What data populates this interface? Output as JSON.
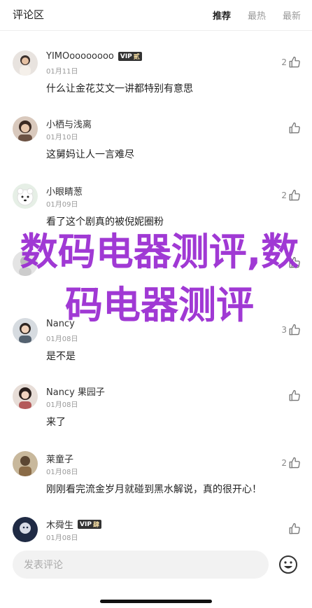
{
  "header": {
    "title": "评论区",
    "tabs": [
      "推荐",
      "最热",
      "最新"
    ]
  },
  "comments": [
    {
      "name": "YIMOoooooooo",
      "vip": "VIP",
      "vip_tag": "贰",
      "date": "01月11日",
      "text": "什么让金花艾文一讲都特别有意思",
      "likes": "2"
    },
    {
      "name": "小栖与浅离",
      "vip": "",
      "vip_tag": "",
      "date": "01月10日",
      "text": "这舅妈让人一言难尽",
      "likes": ""
    },
    {
      "name": "小眼睛葱",
      "vip": "",
      "vip_tag": "",
      "date": "01月09日",
      "text": "看了这个剧真的被倪妮圈粉",
      "likes": "2"
    },
    {
      "name": "",
      "vip": "",
      "vip_tag": "",
      "date": "",
      "text": "",
      "likes": ""
    },
    {
      "name": "Nancy",
      "vip": "",
      "vip_tag": "",
      "date": "01月08日",
      "text": "是不是",
      "likes": "3"
    },
    {
      "name": "Nancy 果园子",
      "vip": "",
      "vip_tag": "",
      "date": "01月08日",
      "text": "来了",
      "likes": ""
    },
    {
      "name": "莱童子",
      "vip": "",
      "vip_tag": "",
      "date": "01月08日",
      "text": "刚刚看完流金岁月就碰到黑水解说，真的很开心！",
      "likes": "2"
    },
    {
      "name": "木舜生",
      "vip": "VIP",
      "vip_tag": "肆",
      "date": "01月08日",
      "text": "",
      "likes": ""
    }
  ],
  "watermark": "数码电器测评,数码电器测评",
  "bottom": {
    "placeholder": "发表评论"
  }
}
